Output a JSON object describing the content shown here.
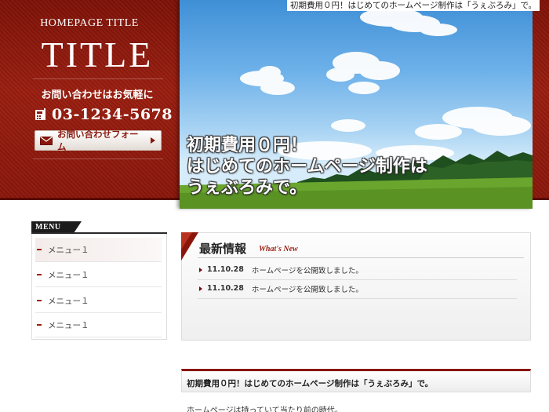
{
  "header": {
    "tagline": "初期費用０円！はじめてのホームページ制作は「うぇぶろみ」で。",
    "site_label": "HOMEPAGE TITLE",
    "site_title": "TITLE",
    "contact_message": "お問い合わせはお気軽に",
    "phone": "03-1234-5678",
    "contact_button": "お問い合わせフォーム",
    "icons": [
      "phone-icon",
      "mail-icon",
      "arrow-right-icon"
    ]
  },
  "hero": {
    "caption_lines": [
      "初期費用０円！",
      "はじめてのホームページ制作は",
      "うぇぶろみで。"
    ]
  },
  "sidebar": {
    "menu_label": "MENU",
    "items": [
      {
        "label": "メニュー１"
      },
      {
        "label": "メニュー１"
      },
      {
        "label": "メニュー１"
      },
      {
        "label": "メニュー１"
      }
    ]
  },
  "news": {
    "title": "最新情報",
    "subtitle": "What's New",
    "items": [
      {
        "date": "11.10.28",
        "text": "ホームページを公開致しました。"
      },
      {
        "date": "11.10.28",
        "text": "ホームページを公開致しました。"
      }
    ]
  },
  "section": {
    "heading": "初期費用０円！はじめてのホームページ制作は「うぇぶろみ」で。",
    "body": "ホームページは持っていて当たり前の時代。"
  },
  "colors": {
    "brand_red": "#8a160b",
    "accent_red": "#9a1e10",
    "sky": "#6fb2ea",
    "grass": "#5f9a2a"
  }
}
